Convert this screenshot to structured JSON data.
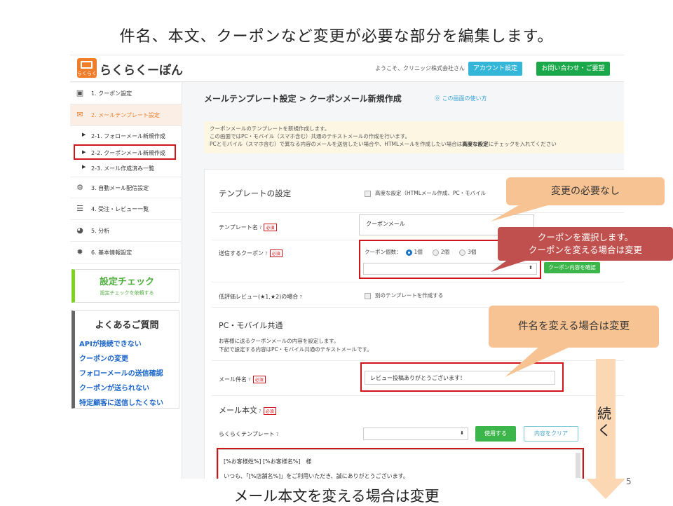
{
  "slide": {
    "title": "件名、本文、クーポンなど変更が必要な部分を編集します。",
    "bottom_caption": "メール本文を変える場合は変更",
    "page_number": "5",
    "continue_label": "続く"
  },
  "header": {
    "logo_small": "らくらく",
    "logo_text": "らくらくーぽん",
    "welcome": "ようこそ、クリニッジ株式会社さん",
    "account_button": "アカウント設定",
    "contact_button": "お問い合わせ・ご要望"
  },
  "sidebar": {
    "items": [
      {
        "label": "1. クーポン設定",
        "icon": "coupon-icon"
      },
      {
        "label": "2. メールテンプレート設定",
        "icon": "mail-icon"
      },
      {
        "label": "3. 自動メール配信設定",
        "icon": "gears-icon"
      },
      {
        "label": "4. 受注・レビュー一覧",
        "icon": "list-icon"
      },
      {
        "label": "5. 分析",
        "icon": "pie-chart-icon"
      },
      {
        "label": "6. 基本情報設定",
        "icon": "gear-icon"
      }
    ],
    "subitems": [
      {
        "label": "2-1. フォローメール新規作成"
      },
      {
        "label": "2-2. クーポンメール新規作成"
      },
      {
        "label": "2-3. メール作成済み一覧"
      }
    ],
    "settings_check": {
      "title": "設定チェック",
      "sub": "設定チェックを依頼する"
    },
    "faq": {
      "title": "よくあるご質問",
      "links": [
        "APIが接続できない",
        "クーポンの変更",
        "フォローメールの送信確認",
        "クーポンが送られない",
        "特定顧客に送信したくない"
      ]
    }
  },
  "main": {
    "breadcrumb": "メールテンプレート設定 > クーポンメール新規作成",
    "help_link": "この画面の使い方",
    "notice_1": "クーポンメールのテンプレートを新規作成します。",
    "notice_2": "この画面ではPC・モバイル（スマホ含む）共通のテキストメールの作成を行います。",
    "notice_3a": "PCとモバイル（スマホ含む）で異なる内容のメールを送信したい場合や、HTMLメールを作成したい場合は",
    "notice_3b": "高度な設定",
    "notice_3c": "にチェックを入れてください",
    "template_section": "テンプレートの設定",
    "advanced_setting": "高度な設定（HTMLメール作成、PC・モバイル",
    "template_name_label": "テンプレート名",
    "template_name_value": "クーポンメール",
    "coupon_label": "送信するクーポン",
    "coupon_count_label": "クーポン個数：",
    "coupon_options": [
      "1個",
      "2個",
      "3個"
    ],
    "coupon_detail_button": "クーポン内容を確認",
    "low_review_label": "低評価レビュー(★1,★2)の場合",
    "low_review_option": "別のテンプレートを作成する",
    "pc_mobile_section": "PC・モバイル共通",
    "pc_mobile_desc_1": "お客様に送るクーポンメールの内容を設定します。",
    "pc_mobile_desc_2": "下記で設定する内容はPC・モバイル共通のテキストメールです。",
    "subject_label": "メール件名",
    "subject_value": "レビュー投稿ありがとうございます！",
    "body_section": "メール本文",
    "rakuraku_template_label": "らくらくテンプレート",
    "use_button": "使用する",
    "clear_button": "内容をクリア",
    "body_line_1": "[%お客様姓%] [%お客様名%]　様",
    "body_line_2": "いつも、「[%店舗名%]」をご利用いただき、誠にありがとうございます。",
    "required_badge": "必須",
    "help_mark": "?"
  },
  "callouts": {
    "no_change": "変更の必要なし",
    "coupon_line_1": "クーポンを選択します。",
    "coupon_line_2": "クーポンを変える場合は変更",
    "subject_change": "件名を変える場合は変更"
  },
  "colors": {
    "accent_orange": "#ef7d2a",
    "highlight_red": "#d0141c",
    "callout_peach": "#f8c393",
    "callout_red": "#c0504d",
    "account_blue": "#33b6d8",
    "contact_green": "#1aa84a"
  }
}
